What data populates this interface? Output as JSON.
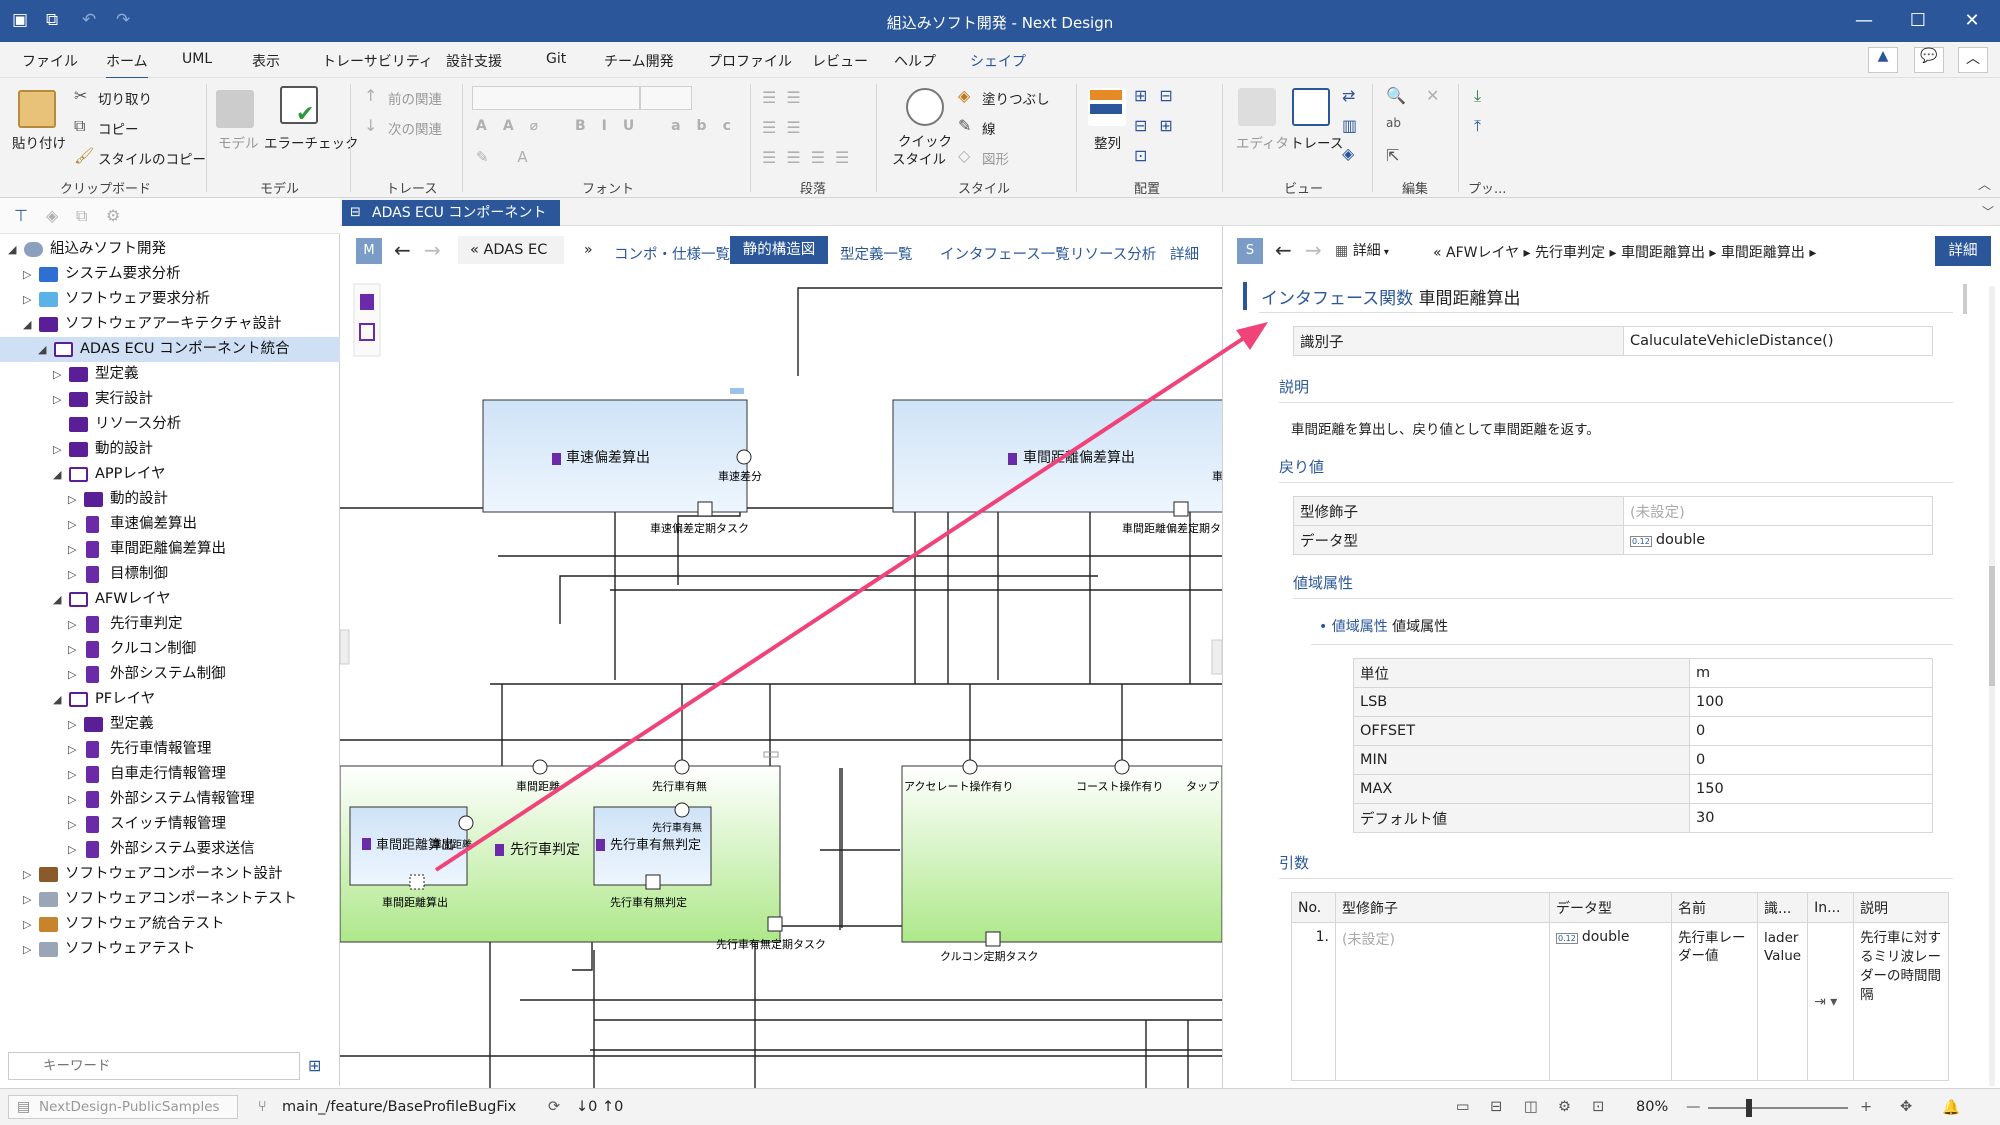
{
  "window": {
    "title": "組込みソフト開発 - Next Design"
  },
  "menu": [
    "ファイル",
    "ホーム",
    "UML",
    "表示",
    "トレーサビリティ",
    "設計支援",
    "Git",
    "チーム開発",
    "プロファイル",
    "レビュー",
    "ヘルプ",
    "シェイプ"
  ],
  "ribbon": {
    "clipboard": {
      "paste": "貼り付け",
      "cut": "切り取り",
      "copy": "コピー",
      "style_copy": "スタイルのコピー",
      "group": "クリップボード"
    },
    "model": {
      "model": "モデル",
      "error_check": "エラーチェック",
      "group": "モデル"
    },
    "trace": {
      "prev": "前の関連",
      "next": "次の関連",
      "group": "トレース"
    },
    "font": {
      "group": "フォント"
    },
    "paragraph": {
      "group": "段落"
    },
    "style": {
      "quick_style_line1": "クイック",
      "quick_style_line2": "スタイル",
      "fill": "塗りつぶし",
      "line": "線",
      "shape": "図形",
      "group": "スタイル"
    },
    "arrange": {
      "align": "整列",
      "group": "配置"
    },
    "view": {
      "editor": "エディタ",
      "trace": "トレース",
      "group": "ビュー"
    },
    "edit": {
      "group": "編集"
    },
    "publish": {
      "group": "プッ..."
    }
  },
  "sidebar": {
    "tree": [
      {
        "label": "組込みソフト開発",
        "level": 0,
        "expanded": true,
        "icon": "project-icon"
      },
      {
        "label": "システム要求分析",
        "level": 1,
        "icon": "folder-blue-icon"
      },
      {
        "label": "ソフトウェア要求分析",
        "level": 1,
        "icon": "folder-lightblue-icon"
      },
      {
        "label": "ソフトウェアアーキテクチャ設計",
        "level": 1,
        "expanded": true,
        "icon": "folder-purple-icon"
      },
      {
        "label": "ADAS ECU コンポーネント統合",
        "level": 2,
        "expanded": true,
        "selected": true,
        "icon": "component-structure-icon"
      },
      {
        "label": "型定義",
        "level": 3,
        "icon": "folder-purple-icon"
      },
      {
        "label": "実行設計",
        "level": 3,
        "icon": "folder-purple-icon"
      },
      {
        "label": "リソース分析",
        "level": 3,
        "icon": "folder-purple-icon",
        "leaf": true
      },
      {
        "label": "動的設計",
        "level": 3,
        "icon": "folder-purple-icon"
      },
      {
        "label": "APPレイヤ",
        "level": 3,
        "expanded": true,
        "icon": "component-structure-icon"
      },
      {
        "label": "動的設計",
        "level": 4,
        "icon": "folder-purple-icon"
      },
      {
        "label": "車速偏差算出",
        "level": 4,
        "icon": "component-icon"
      },
      {
        "label": "車間距離偏差算出",
        "level": 4,
        "icon": "component-icon"
      },
      {
        "label": "目標制御",
        "level": 4,
        "icon": "component-icon"
      },
      {
        "label": "AFWレイヤ",
        "level": 3,
        "expanded": true,
        "icon": "component-structure-icon"
      },
      {
        "label": "先行車判定",
        "level": 4,
        "icon": "component-icon"
      },
      {
        "label": "クルコン制御",
        "level": 4,
        "icon": "component-icon"
      },
      {
        "label": "外部システム制御",
        "level": 4,
        "icon": "component-icon"
      },
      {
        "label": "PFレイヤ",
        "level": 3,
        "expanded": true,
        "icon": "component-structure-icon"
      },
      {
        "label": "型定義",
        "level": 4,
        "icon": "folder-purple-icon"
      },
      {
        "label": "先行車情報管理",
        "level": 4,
        "icon": "component-icon"
      },
      {
        "label": "自車走行情報管理",
        "level": 4,
        "icon": "component-icon"
      },
      {
        "label": "外部システム情報管理",
        "level": 4,
        "icon": "component-icon"
      },
      {
        "label": "スイッチ情報管理",
        "level": 4,
        "icon": "component-icon"
      },
      {
        "label": "外部システム要求送信",
        "level": 4,
        "icon": "component-icon"
      },
      {
        "label": "ソフトウェアコンポーネント設計",
        "level": 1,
        "icon": "folder-brown-icon"
      },
      {
        "label": "ソフトウェアコンポーネントテスト",
        "level": 1,
        "icon": "folder-gray-icon"
      },
      {
        "label": "ソフトウェア統合テスト",
        "level": 1,
        "icon": "folder-orange-icon"
      },
      {
        "label": "ソフトウェアテスト",
        "level": 1,
        "icon": "folder-gray-icon"
      }
    ],
    "keyword_placeholder": "キーワード"
  },
  "document_tab": {
    "label": "ADAS ECU コンポーネント統合"
  },
  "editor": {
    "mode_badge": "M",
    "breadcrumb": "« ADAS EC",
    "more": "»",
    "views": [
      "コンポ・仕様一覧",
      "静的構造図",
      "型定義一覧",
      "インタフェース一覧",
      "リソース分析",
      "詳細"
    ],
    "active_view": "静的構造図"
  },
  "diagram": {
    "components": [
      {
        "name": "車速偏差算出",
        "ports": [
          "車速差分",
          "車速偏差定期タスク"
        ]
      },
      {
        "name": "車間距離偏差算出",
        "ports": [
          "車間距離偏差定期タ"
        ]
      },
      {
        "name": "先行車判定",
        "ports": [
          "車間距離",
          "先行車有無",
          "先行車有無定期タスク"
        ]
      },
      {
        "name": "車間距離算出",
        "ports": [
          "車間距離",
          "車間距離算出"
        ]
      },
      {
        "name": "先行車有無判定",
        "ports": [
          "先行車有無",
          "先行車有無判定"
        ]
      },
      {
        "name": "クルコン制御",
        "ports": [
          "アクセレート操作有り",
          "コースト操作有り",
          "タップ",
          "クルコン定期タスク"
        ]
      }
    ]
  },
  "detail": {
    "mode_badge": "S",
    "view_menu": "詳細",
    "breadcrumb": [
      "«",
      "AFWレイヤ",
      "先行車判定",
      "車間距離算出",
      "車間距離算出"
    ],
    "detail_button": "詳細",
    "heading_type": "インタフェース関数",
    "heading_name": "車間距離算出",
    "identifier_label": "識別子",
    "identifier_value": "CaluculateVehicleDistance()",
    "description_section": "説明",
    "description_text": "車間距離を算出し、戻り値として車間距離を返す。",
    "return_section": "戻り値",
    "return_rows": [
      {
        "label": "型修飾子",
        "value": "(未設定)",
        "muted": true
      },
      {
        "label": "データ型",
        "value": "double",
        "type_badge": "0.12"
      }
    ],
    "range_section": "値域属性",
    "range_item_type": "値域属性",
    "range_item_name": "値域属性",
    "range_rows": [
      {
        "label": "単位",
        "value": "m"
      },
      {
        "label": "LSB",
        "value": "100"
      },
      {
        "label": "OFFSET",
        "value": "0"
      },
      {
        "label": "MIN",
        "value": "0"
      },
      {
        "label": "MAX",
        "value": "150"
      },
      {
        "label": "デフォルト値",
        "value": "30"
      }
    ],
    "args_section": "引数",
    "args_columns": [
      "No.",
      "型修飾子",
      "データ型",
      "名前",
      "識...",
      "In...",
      "説明"
    ],
    "args_rows": [
      {
        "no": "1.",
        "modifier": "(未設定)",
        "type": "double",
        "type_badge": "0.12",
        "name": "先行車レーダー値",
        "id": "lader Value",
        "desc": "先行車に対するミリ波レーダーの時間間隔"
      }
    ]
  },
  "status": {
    "repo": "NextDesign-PublicSamples",
    "branch": "main_/feature/BaseProfileBugFix",
    "sync": "↓0 ↑0",
    "zoom": "80%"
  }
}
